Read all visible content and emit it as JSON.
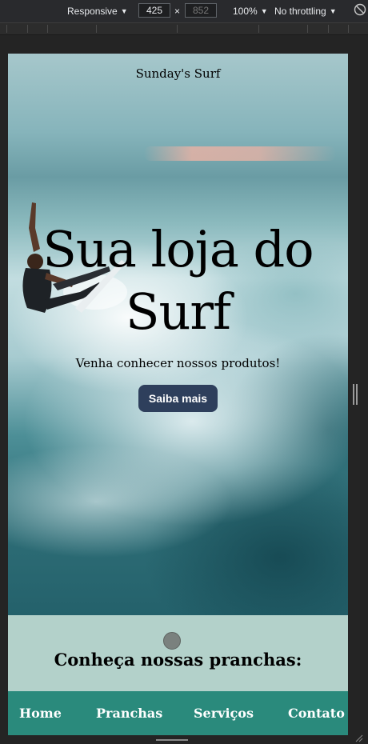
{
  "devtools": {
    "device_mode": "Responsive",
    "width": "425",
    "times_sign": "×",
    "height": "852",
    "zoom": "100%",
    "throttling": "No throttling",
    "caret": "▼"
  },
  "page": {
    "site_name": "Sunday's Surf",
    "hero_title": "Sua loja do Surf",
    "hero_subtitle": "Venha conhecer nossos produtos!",
    "cta_label": "Saiba mais",
    "section_heading": "Conheça nossas pranchas:",
    "nav": [
      "Home",
      "Pranchas",
      "Serviços",
      "Contato"
    ]
  },
  "colors": {
    "button": "#2e3f5c",
    "navbar": "#2a8a7c",
    "section_bg": "#b3d1ca"
  }
}
